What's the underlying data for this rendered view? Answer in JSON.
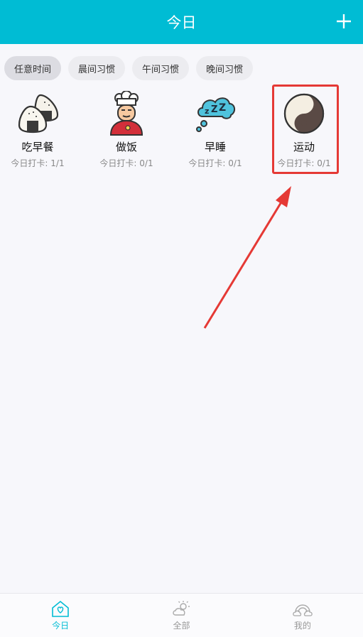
{
  "header": {
    "title": "今日",
    "add_icon": "plus-icon"
  },
  "tabs": [
    {
      "label": "任意时间",
      "active": true
    },
    {
      "label": "晨间习惯",
      "active": false
    },
    {
      "label": "午间习惯",
      "active": false
    },
    {
      "label": "晚间习惯",
      "active": false
    }
  ],
  "habits": [
    {
      "name": "吃早餐",
      "count": "今日打卡: 1/1",
      "icon": "rice-ball-icon"
    },
    {
      "name": "做饭",
      "count": "今日打卡: 0/1",
      "icon": "chef-icon"
    },
    {
      "name": "早睡",
      "count": "今日打卡: 0/1",
      "icon": "sleep-cloud-icon"
    },
    {
      "name": "运动",
      "count": "今日打卡: 0/1",
      "icon": "yin-yang-icon"
    }
  ],
  "nav": [
    {
      "label": "今日",
      "icon": "home-heart-icon",
      "active": true
    },
    {
      "label": "全部",
      "icon": "sun-cloud-icon",
      "active": false
    },
    {
      "label": "我的",
      "icon": "rainbow-cloud-icon",
      "active": false
    }
  ],
  "colors": {
    "primary": "#00bcd4",
    "highlight": "#e53935"
  }
}
